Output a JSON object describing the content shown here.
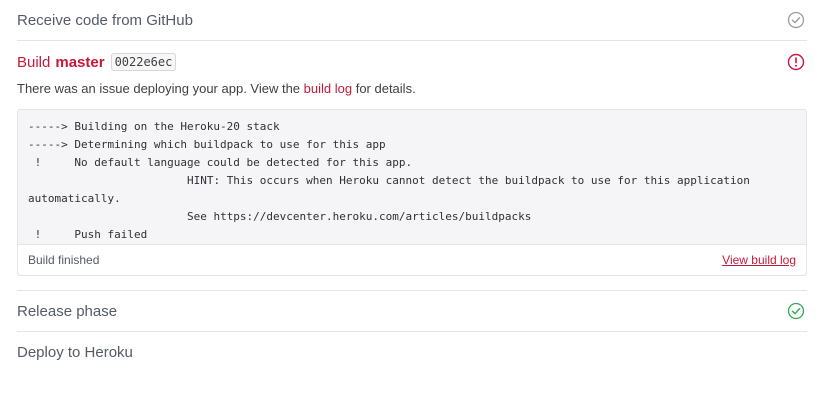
{
  "steps": {
    "receive": {
      "label": "Receive code from GitHub",
      "icon": "check-circle-icon",
      "status": "done"
    },
    "release": {
      "label": "Release phase",
      "icon": "check-circle-icon",
      "status": "success"
    },
    "deploy": {
      "label": "Deploy to Heroku"
    }
  },
  "build": {
    "title_prefix": "Build",
    "branch": "master",
    "commit": "0022e6ec",
    "icon": "error-circle-icon",
    "issue_before": "There was an issue deploying your app. View the ",
    "issue_link": "build log",
    "issue_after": " for details."
  },
  "log": {
    "text": "-----> Building on the Heroku-20 stack\n-----> Determining which buildpack to use for this app\n !     No default language could be detected for this app.\n\t\t\tHINT: This occurs when Heroku cannot detect the buildpack to use for this application automatically.\n\t\t\tSee https://devcenter.heroku.com/articles/buildpacks\n !     Push failed",
    "status": "Build finished",
    "view_link": "View build log"
  },
  "colors": {
    "accent": "#c6183a",
    "success": "#35a853",
    "muted": "#9a9aa2"
  }
}
